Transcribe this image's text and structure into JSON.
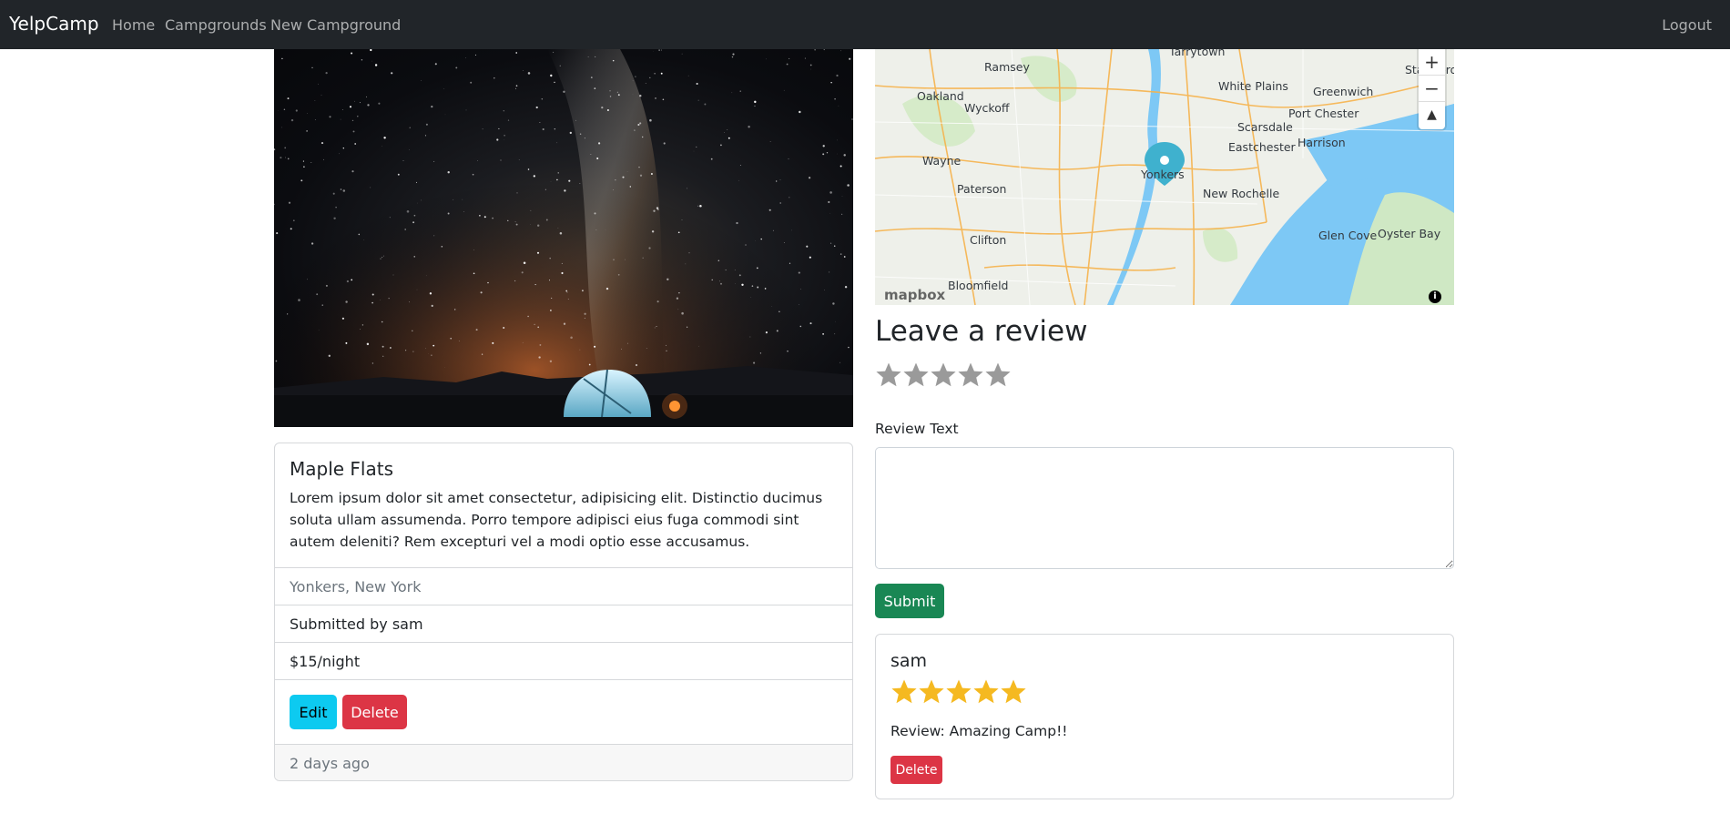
{
  "nav": {
    "brand": "YelpCamp",
    "links": [
      "Home",
      "Campgrounds",
      "New Campground"
    ],
    "logout": "Logout"
  },
  "campground": {
    "title": "Maple Flats",
    "description": "Lorem ipsum dolor sit amet consectetur, adipisicing elit. Distinctio ducimus soluta ullam assumenda. Porro tempore adipisci eius fuga commodi sint autem deleniti? Rem excepturi vel a modi optio esse accusamus.",
    "location": "Yonkers, New York",
    "submitted_by": "Submitted by sam",
    "price": "$15/night",
    "edit_label": "Edit",
    "delete_label": "Delete",
    "footer": "2 days ago"
  },
  "map": {
    "labels": [
      "Tarrytown",
      "Ramsey",
      "White Plains",
      "Greenwich",
      "Stamford",
      "Oakland",
      "Wyckoff",
      "Port Chester",
      "Scarsdale",
      "Harrison",
      "Eastchester",
      "Wayne",
      "Yonkers",
      "Paterson",
      "New Rochelle",
      "Clifton",
      "Glen Cove",
      "Oyster Bay",
      "Bloomfield"
    ],
    "zoom_in": "+",
    "zoom_out": "−",
    "compass": "▲",
    "attribution_logo": "mapbox",
    "info": "i"
  },
  "review_form": {
    "heading": "Leave a review",
    "rating": 0,
    "text_label": "Review Text",
    "text_value": "",
    "submit_label": "Submit"
  },
  "reviews": [
    {
      "author": "sam",
      "rating": 5,
      "body": "Review: Amazing Camp!!",
      "delete_label": "Delete"
    }
  ],
  "colors": {
    "navbar": "#212529",
    "star_filled": "#f5b921",
    "star_empty": "#9a9a9a",
    "info_button": "#0dcaf0",
    "danger": "#dc3545",
    "success": "#198754",
    "map_marker": "#3fb1ce"
  }
}
